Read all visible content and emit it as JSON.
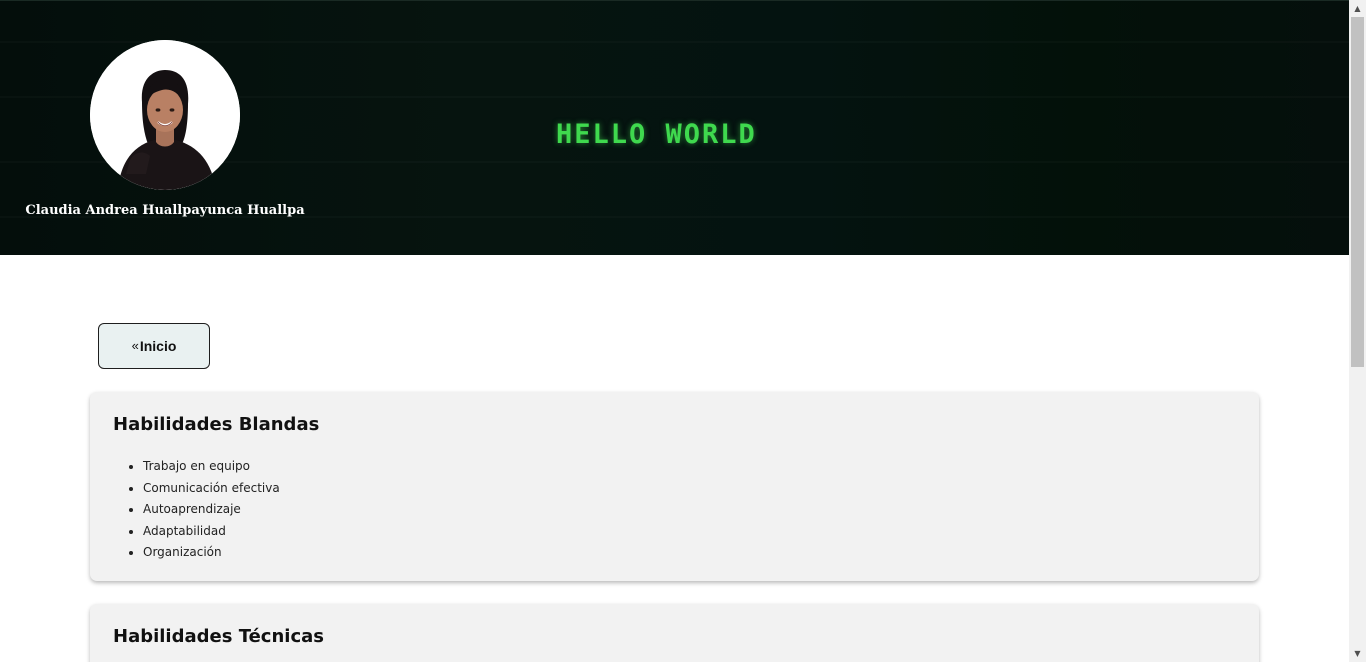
{
  "header": {
    "profile_name": "Claudia Andrea Huallpayunca Huallpa",
    "banner_text": "HELLO WORLD",
    "banner_color": "#3fd94e"
  },
  "nav": {
    "back_icon": "double-chevron-left-icon",
    "back_label": "Inicio"
  },
  "sections": [
    {
      "title": "Habilidades Blandas",
      "items": [
        "Trabajo en equipo",
        "Comunicación efectiva",
        "Autoaprendizaje",
        "Adaptabilidad",
        "Organización"
      ]
    },
    {
      "title": "Habilidades Técnicas",
      "items": []
    }
  ],
  "scrollbar": {
    "up_icon": "scroll-up-arrow-icon",
    "down_icon": "scroll-down-arrow-icon"
  }
}
